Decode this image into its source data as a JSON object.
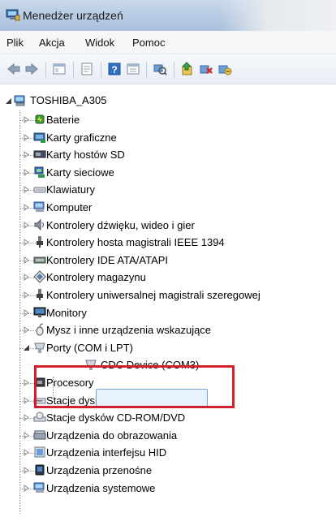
{
  "window": {
    "title": "Menedżer urządzeń",
    "icon": "device-manager-icon"
  },
  "menu": [
    {
      "label": "Plik"
    },
    {
      "label": "Akcja"
    },
    {
      "label": "Widok"
    },
    {
      "label": "Pomoc"
    }
  ],
  "toolbar": {
    "buttons": [
      "back-arrow-icon",
      "forward-arrow-icon",
      "console-tree-icon",
      "properties-icon",
      "help-icon",
      "view-icon",
      "scan-hardware-icon",
      "update-driver-icon",
      "uninstall-icon",
      "disable-icon"
    ]
  },
  "tree": {
    "root": {
      "label": "TOSHIBA_A305",
      "icon": "computer-icon",
      "expanded": true
    },
    "items": [
      {
        "label": "Baterie",
        "icon": "battery-icon"
      },
      {
        "label": "Karty graficzne",
        "icon": "display-adapter-icon"
      },
      {
        "label": "Karty hostów SD",
        "icon": "sd-host-icon"
      },
      {
        "label": "Karty sieciowe",
        "icon": "network-adapter-icon"
      },
      {
        "label": "Klawiatury",
        "icon": "keyboard-icon"
      },
      {
        "label": "Komputer",
        "icon": "computer-icon"
      },
      {
        "label": "Kontrolery dźwięku, wideo i gier",
        "icon": "speaker-icon"
      },
      {
        "label": "Kontrolery hosta magistrali IEEE 1394",
        "icon": "firewire-icon"
      },
      {
        "label": "Kontrolery IDE ATA/ATAPI",
        "icon": "ide-controller-icon"
      },
      {
        "label": "Kontrolery magazynu",
        "icon": "storage-controller-icon"
      },
      {
        "label": "Kontrolery uniwersalnej magistrali szeregowej",
        "icon": "usb-controller-icon"
      },
      {
        "label": "Monitory",
        "icon": "monitor-icon"
      },
      {
        "label": "Mysz i inne urządzenia wskazujące",
        "icon": "mouse-icon"
      },
      {
        "label": "Porty (COM i LPT)",
        "icon": "port-icon",
        "expanded": true,
        "children": [
          {
            "label": "CDC Device (COM3)",
            "icon": "port-icon",
            "selected": true
          }
        ]
      },
      {
        "label": "Procesory",
        "icon": "processor-icon"
      },
      {
        "label": "Stacje dysków",
        "icon": "disk-drive-icon"
      },
      {
        "label": "Stacje dysków CD-ROM/DVD",
        "icon": "cd-drive-icon"
      },
      {
        "label": "Urządzenia do obrazowania",
        "icon": "scanner-icon"
      },
      {
        "label": "Urządzenia interfejsu HID",
        "icon": "hid-icon"
      },
      {
        "label": "Urządzenia przenośne",
        "icon": "portable-device-icon"
      },
      {
        "label": "Urządzenia systemowe",
        "icon": "system-device-icon"
      }
    ]
  },
  "colors": {
    "highlight_border": "#d3202e",
    "selection_fill": "#e8f2fd",
    "selection_border": "#7da2ce"
  }
}
